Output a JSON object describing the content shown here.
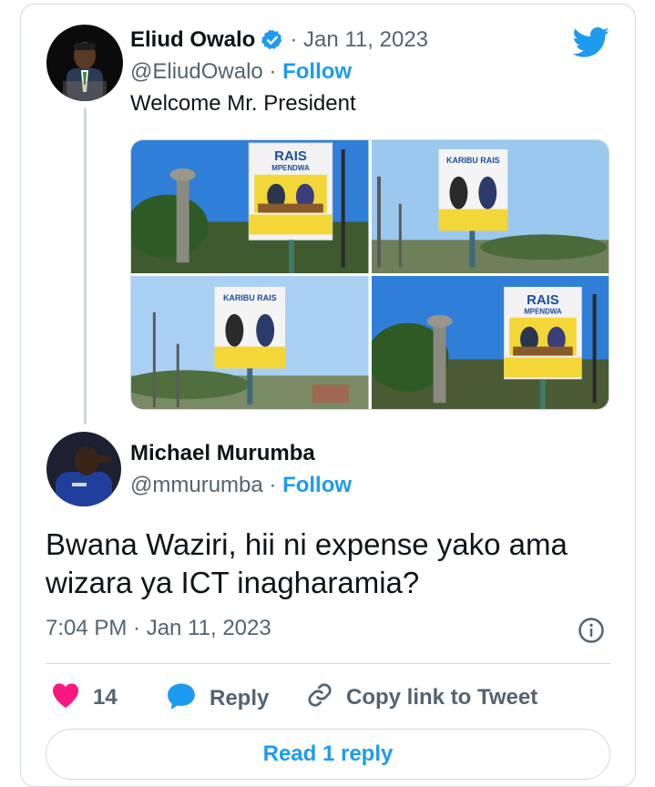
{
  "colors": {
    "accent": "#1d9bf0",
    "secondary_text": "#536471",
    "primary_text": "#0f1419",
    "heart": "#f91880",
    "border": "#cfd9de"
  },
  "tweet": {
    "display_name": "Eliud Owalo",
    "verified_icon": "verified-badge-icon",
    "date_text": "· Jan 11, 2023",
    "handle": "@EliudOwalo",
    "follow_separator": " · ",
    "follow_label": "Follow",
    "text": "Welcome Mr. President",
    "logo_icon": "twitter-bird-icon",
    "images": [
      {
        "billboard_line1": "RAIS",
        "billboard_line2": "MPENDWA"
      },
      {
        "billboard_line1": "KARIBU RAIS"
      },
      {
        "billboard_line1": "KARIBU RAIS"
      },
      {
        "billboard_line1": "RAIS",
        "billboard_line2": "MPENDWA"
      }
    ]
  },
  "reply": {
    "display_name": "Michael Murumba",
    "handle": "@mmurumba",
    "follow_separator": " · ",
    "follow_label": "Follow",
    "text": "Bwana Waziri, hii ni expense yako ama wizara ya ICT inagharamia?",
    "timestamp": "7:04 PM · Jan 11, 2023",
    "info_icon": "info-icon"
  },
  "actions": {
    "like_icon": "heart-icon",
    "like_count": "14",
    "reply_icon": "reply-bubble-icon",
    "reply_label": "Reply",
    "copy_icon": "link-icon",
    "copy_label": "Copy link to Tweet"
  },
  "read_replies_label": "Read 1 reply"
}
